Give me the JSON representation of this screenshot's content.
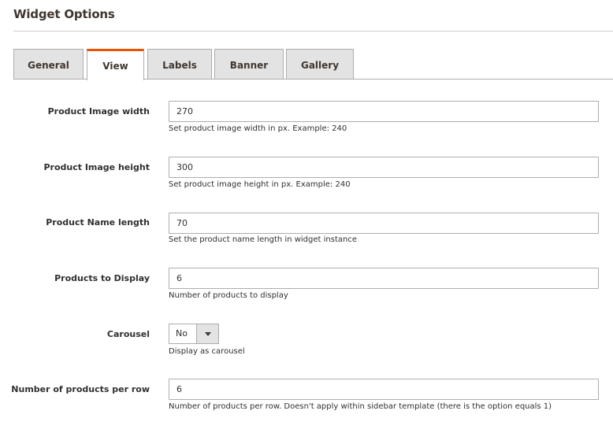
{
  "section": {
    "title": "Widget Options"
  },
  "tabs": [
    {
      "label": "General",
      "active": false
    },
    {
      "label": "View",
      "active": true
    },
    {
      "label": "Labels",
      "active": false
    },
    {
      "label": "Banner",
      "active": false
    },
    {
      "label": "Gallery",
      "active": false
    }
  ],
  "fields": {
    "image_width": {
      "label": "Product Image width",
      "value": "270",
      "note": "Set product image width in px. Example: 240"
    },
    "image_height": {
      "label": "Product Image height",
      "value": "300",
      "note": "Set product image height in px. Example: 240"
    },
    "name_length": {
      "label": "Product Name length",
      "value": "70",
      "note": "Set the product name length in widget instance"
    },
    "products_to_display": {
      "label": "Products to Display",
      "value": "6",
      "note": "Number of products to display"
    },
    "carousel": {
      "label": "Carousel",
      "value": "No",
      "note": "Display as carousel"
    },
    "products_per_row": {
      "label": "Number of products per row",
      "value": "6",
      "note": "Number of products per row. Doesn't apply within sidebar template (there is the option equals 1)"
    }
  },
  "colors": {
    "accent": "#eb5202",
    "tab_bg": "#e3e3e3",
    "border": "#adadad",
    "text": "#303030",
    "heading": "#41362f"
  },
  "icons": {
    "select_toggle": "caret-down-icon"
  }
}
